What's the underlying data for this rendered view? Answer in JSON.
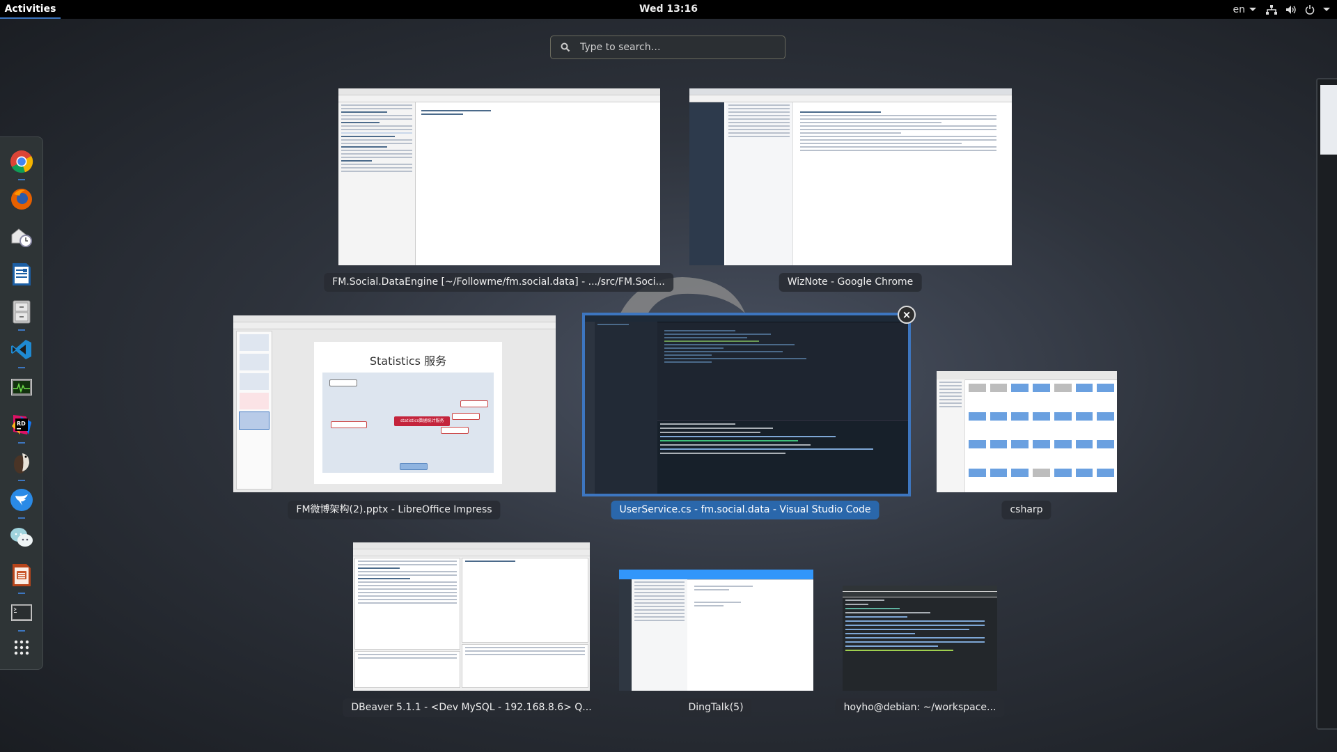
{
  "topbar": {
    "activities_label": "Activities",
    "clock": "Wed 13:16",
    "language": "en",
    "tray_icons": [
      "network-wired-icon",
      "volume-icon",
      "power-icon"
    ]
  },
  "search": {
    "placeholder": "Type to search…",
    "value": ""
  },
  "dock": {
    "items": [
      {
        "name": "Google Chrome",
        "icon": "chrome-icon",
        "running": true
      },
      {
        "name": "Firefox",
        "icon": "firefox-icon",
        "running": false
      },
      {
        "name": "Evolution",
        "icon": "mail-clock-icon",
        "running": false
      },
      {
        "name": "LibreOffice Writer",
        "icon": "writer-icon",
        "running": false
      },
      {
        "name": "Files",
        "icon": "file-cabinet-icon",
        "running": true
      },
      {
        "name": "Visual Studio Code",
        "icon": "vscode-icon",
        "running": true
      },
      {
        "name": "System Monitor",
        "icon": "system-monitor-icon",
        "running": false
      },
      {
        "name": "JetBrains Rider",
        "icon": "rider-icon",
        "running": true
      },
      {
        "name": "DBeaver",
        "icon": "dbeaver-icon",
        "running": true
      },
      {
        "name": "DingTalk",
        "icon": "dingtalk-icon",
        "running": true
      },
      {
        "name": "WeChat",
        "icon": "wechat-icon",
        "running": false
      },
      {
        "name": "LibreOffice Impress",
        "icon": "impress-icon",
        "running": true
      },
      {
        "name": "Terminal",
        "icon": "terminal-icon",
        "running": true
      }
    ],
    "show_apps_icon": "app-grid-icon"
  },
  "windows": [
    {
      "title": "FM.Social.DataEngine [~/Followme/fm.social.data] - .../src/FM.Soci...",
      "app": "rider",
      "selected": false
    },
    {
      "title": "WizNote - Google Chrome",
      "app": "chrome",
      "selected": false
    },
    {
      "title": "FM微博架构(2).pptx - LibreOffice Impress",
      "app": "impress",
      "selected": false,
      "slide_title": "Statistics 服务",
      "mindmap_center": "statistics数据统计服务"
    },
    {
      "title": "UserService.cs - fm.social.data - Visual Studio Code",
      "app": "vscode",
      "selected": true
    },
    {
      "title": "csharp",
      "app": "files",
      "selected": false
    },
    {
      "title": "DBeaver 5.1.1 - <Dev MySQL - 192.168.8.6> Q...",
      "app": "dbeaver",
      "selected": false
    },
    {
      "title": "DingTalk(5)",
      "app": "dingtalk",
      "selected": false
    },
    {
      "title": "hoyho@debian: ~/workspace...",
      "app": "terminal",
      "selected": false
    }
  ],
  "colors": {
    "accent": "#3d76c0",
    "selected_label": "#2a67ab",
    "topbar": "#000000",
    "dock_bg": "#2e3436"
  }
}
